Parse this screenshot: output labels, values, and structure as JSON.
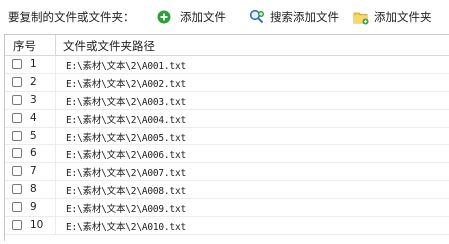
{
  "toolbar": {
    "label": "要复制的文件或文件夹：",
    "add_file": "添加文件",
    "search_add_file": "搜索添加文件",
    "add_folder": "添加文件夹",
    "icons": [
      "add-circle-icon",
      "search-add-icon",
      "add-folder-icon"
    ],
    "accent": "#2e9e3a"
  },
  "table": {
    "columns": [
      "序号",
      "文件或文件夹路径"
    ],
    "rows": [
      {
        "index": "1",
        "path": "E:\\素材\\文本\\2\\A001.txt"
      },
      {
        "index": "2",
        "path": "E:\\素材\\文本\\2\\A002.txt"
      },
      {
        "index": "3",
        "path": "E:\\素材\\文本\\2\\A003.txt"
      },
      {
        "index": "4",
        "path": "E:\\素材\\文本\\2\\A004.txt"
      },
      {
        "index": "5",
        "path": "E:\\素材\\文本\\2\\A005.txt"
      },
      {
        "index": "6",
        "path": "E:\\素材\\文本\\2\\A006.txt"
      },
      {
        "index": "7",
        "path": "E:\\素材\\文本\\2\\A007.txt"
      },
      {
        "index": "8",
        "path": "E:\\素材\\文本\\2\\A008.txt"
      },
      {
        "index": "9",
        "path": "E:\\素材\\文本\\2\\A009.txt"
      },
      {
        "index": "10",
        "path": "E:\\素材\\文本\\2\\A010.txt"
      }
    ]
  }
}
